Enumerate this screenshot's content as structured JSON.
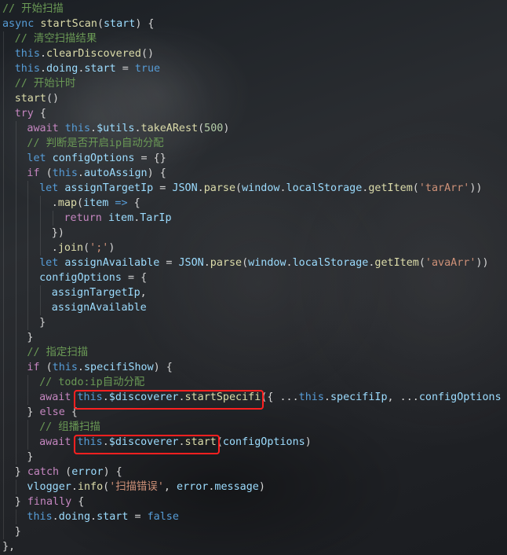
{
  "editor": {
    "lines": [
      [
        {
          "t": "// 开始扫描",
          "c": "comment"
        }
      ],
      [
        {
          "t": "async ",
          "c": "kw"
        },
        {
          "t": "startScan",
          "c": "fn"
        },
        {
          "t": "(",
          "c": "plain"
        },
        {
          "t": "start",
          "c": "var"
        },
        {
          "t": ") {",
          "c": "plain"
        }
      ],
      [
        {
          "t": "// 清空扫描结果",
          "c": "comment"
        }
      ],
      [
        {
          "t": "this",
          "c": "kw"
        },
        {
          "t": ".",
          "c": "plain"
        },
        {
          "t": "clearDiscovered",
          "c": "fn"
        },
        {
          "t": "()",
          "c": "plain"
        }
      ],
      [
        {
          "t": "this",
          "c": "kw"
        },
        {
          "t": ".",
          "c": "plain"
        },
        {
          "t": "doing",
          "c": "var"
        },
        {
          "t": ".",
          "c": "plain"
        },
        {
          "t": "start",
          "c": "var"
        },
        {
          "t": " = ",
          "c": "plain"
        },
        {
          "t": "true",
          "c": "kw"
        }
      ],
      [
        {
          "t": "// 开始计时",
          "c": "comment"
        }
      ],
      [
        {
          "t": "start",
          "c": "fn"
        },
        {
          "t": "()",
          "c": "plain"
        }
      ],
      [
        {
          "t": "try",
          "c": "ctl"
        },
        {
          "t": " {",
          "c": "plain"
        }
      ],
      [
        {
          "t": "await ",
          "c": "ctl"
        },
        {
          "t": "this",
          "c": "kw"
        },
        {
          "t": ".",
          "c": "plain"
        },
        {
          "t": "$utils",
          "c": "var"
        },
        {
          "t": ".",
          "c": "plain"
        },
        {
          "t": "takeARest",
          "c": "fn"
        },
        {
          "t": "(",
          "c": "plain"
        },
        {
          "t": "500",
          "c": "num"
        },
        {
          "t": ")",
          "c": "plain"
        }
      ],
      [
        {
          "t": "// 判断是否开启ip自动分配",
          "c": "comment"
        }
      ],
      [
        {
          "t": "let ",
          "c": "kw"
        },
        {
          "t": "configOptions",
          "c": "var"
        },
        {
          "t": " = {}",
          "c": "plain"
        }
      ],
      [
        {
          "t": "if",
          "c": "ctl"
        },
        {
          "t": " (",
          "c": "plain"
        },
        {
          "t": "this",
          "c": "kw"
        },
        {
          "t": ".",
          "c": "plain"
        },
        {
          "t": "autoAssign",
          "c": "var"
        },
        {
          "t": ") {",
          "c": "plain"
        }
      ],
      [
        {
          "t": "let ",
          "c": "kw"
        },
        {
          "t": "assignTargetIp",
          "c": "var"
        },
        {
          "t": " = ",
          "c": "plain"
        },
        {
          "t": "JSON",
          "c": "var"
        },
        {
          "t": ".",
          "c": "plain"
        },
        {
          "t": "parse",
          "c": "fn"
        },
        {
          "t": "(",
          "c": "plain"
        },
        {
          "t": "window",
          "c": "var"
        },
        {
          "t": ".",
          "c": "plain"
        },
        {
          "t": "localStorage",
          "c": "var"
        },
        {
          "t": ".",
          "c": "plain"
        },
        {
          "t": "getItem",
          "c": "fn"
        },
        {
          "t": "(",
          "c": "plain"
        },
        {
          "t": "'tarArr'",
          "c": "str"
        },
        {
          "t": "))",
          "c": "plain"
        }
      ],
      [
        {
          "t": ".",
          "c": "plain"
        },
        {
          "t": "map",
          "c": "fn"
        },
        {
          "t": "(",
          "c": "plain"
        },
        {
          "t": "item",
          "c": "var"
        },
        {
          "t": " => ",
          "c": "kw"
        },
        {
          "t": "{",
          "c": "plain"
        }
      ],
      [
        {
          "t": "return ",
          "c": "ctl"
        },
        {
          "t": "item",
          "c": "var"
        },
        {
          "t": ".",
          "c": "plain"
        },
        {
          "t": "TarIp",
          "c": "var"
        }
      ],
      [
        {
          "t": "})",
          "c": "plain"
        }
      ],
      [
        {
          "t": ".",
          "c": "plain"
        },
        {
          "t": "join",
          "c": "fn"
        },
        {
          "t": "(",
          "c": "plain"
        },
        {
          "t": "';'",
          "c": "str"
        },
        {
          "t": ")",
          "c": "plain"
        }
      ],
      [
        {
          "t": "let ",
          "c": "kw"
        },
        {
          "t": "assignAvailable",
          "c": "var"
        },
        {
          "t": " = ",
          "c": "plain"
        },
        {
          "t": "JSON",
          "c": "var"
        },
        {
          "t": ".",
          "c": "plain"
        },
        {
          "t": "parse",
          "c": "fn"
        },
        {
          "t": "(",
          "c": "plain"
        },
        {
          "t": "window",
          "c": "var"
        },
        {
          "t": ".",
          "c": "plain"
        },
        {
          "t": "localStorage",
          "c": "var"
        },
        {
          "t": ".",
          "c": "plain"
        },
        {
          "t": "getItem",
          "c": "fn"
        },
        {
          "t": "(",
          "c": "plain"
        },
        {
          "t": "'avaArr'",
          "c": "str"
        },
        {
          "t": "))",
          "c": "plain"
        }
      ],
      [
        {
          "t": "configOptions",
          "c": "var"
        },
        {
          "t": " = {",
          "c": "plain"
        }
      ],
      [
        {
          "t": "assignTargetIp",
          "c": "var"
        },
        {
          "t": ",",
          "c": "plain"
        }
      ],
      [
        {
          "t": "assignAvailable",
          "c": "var"
        }
      ],
      [
        {
          "t": "}",
          "c": "plain"
        }
      ],
      [
        {
          "t": "}",
          "c": "plain"
        }
      ],
      [
        {
          "t": "// 指定扫描",
          "c": "comment"
        }
      ],
      [
        {
          "t": "if",
          "c": "ctl"
        },
        {
          "t": " (",
          "c": "plain"
        },
        {
          "t": "this",
          "c": "kw"
        },
        {
          "t": ".",
          "c": "plain"
        },
        {
          "t": "specifiShow",
          "c": "var"
        },
        {
          "t": ") {",
          "c": "plain"
        }
      ],
      [
        {
          "t": "// todo:ip自动分配",
          "c": "comment"
        }
      ],
      [
        {
          "t": "await ",
          "c": "ctl"
        },
        {
          "t": "this",
          "c": "kw"
        },
        {
          "t": ".",
          "c": "plain"
        },
        {
          "t": "$discoverer",
          "c": "var"
        },
        {
          "t": ".",
          "c": "plain"
        },
        {
          "t": "startSpecifi",
          "c": "fn"
        },
        {
          "t": "({ ...",
          "c": "plain"
        },
        {
          "t": "this",
          "c": "kw"
        },
        {
          "t": ".",
          "c": "plain"
        },
        {
          "t": "specifiIp",
          "c": "var"
        },
        {
          "t": ", ...",
          "c": "plain"
        },
        {
          "t": "configOptions",
          "c": "var"
        },
        {
          "t": " })",
          "c": "plain"
        }
      ],
      [
        {
          "t": "} ",
          "c": "plain"
        },
        {
          "t": "else",
          "c": "ctl"
        },
        {
          "t": " {",
          "c": "plain"
        }
      ],
      [
        {
          "t": "// 组播扫描",
          "c": "comment"
        }
      ],
      [
        {
          "t": "await ",
          "c": "ctl"
        },
        {
          "t": "this",
          "c": "kw"
        },
        {
          "t": ".",
          "c": "plain"
        },
        {
          "t": "$discoverer",
          "c": "var"
        },
        {
          "t": ".",
          "c": "plain"
        },
        {
          "t": "start",
          "c": "fn"
        },
        {
          "t": "(",
          "c": "plain"
        },
        {
          "t": "configOptions",
          "c": "var"
        },
        {
          "t": ")",
          "c": "plain"
        }
      ],
      [
        {
          "t": "}",
          "c": "plain"
        }
      ],
      [
        {
          "t": "} ",
          "c": "plain"
        },
        {
          "t": "catch",
          "c": "ctl"
        },
        {
          "t": " (",
          "c": "plain"
        },
        {
          "t": "error",
          "c": "var"
        },
        {
          "t": ") {",
          "c": "plain"
        }
      ],
      [
        {
          "t": "vlogger",
          "c": "var"
        },
        {
          "t": ".",
          "c": "plain"
        },
        {
          "t": "info",
          "c": "fn"
        },
        {
          "t": "(",
          "c": "plain"
        },
        {
          "t": "'扫描错误'",
          "c": "str"
        },
        {
          "t": ", ",
          "c": "plain"
        },
        {
          "t": "error",
          "c": "var"
        },
        {
          "t": ".",
          "c": "plain"
        },
        {
          "t": "message",
          "c": "var"
        },
        {
          "t": ")",
          "c": "plain"
        }
      ],
      [
        {
          "t": "} ",
          "c": "plain"
        },
        {
          "t": "finally",
          "c": "ctl"
        },
        {
          "t": " {",
          "c": "plain"
        }
      ],
      [
        {
          "t": "this",
          "c": "kw"
        },
        {
          "t": ".",
          "c": "plain"
        },
        {
          "t": "doing",
          "c": "var"
        },
        {
          "t": ".",
          "c": "plain"
        },
        {
          "t": "start",
          "c": "var"
        },
        {
          "t": " = ",
          "c": "plain"
        },
        {
          "t": "false",
          "c": "kw"
        }
      ],
      [
        {
          "t": "}",
          "c": "plain"
        }
      ],
      [
        {
          "t": "},",
          "c": "plain"
        }
      ]
    ]
  },
  "colors": {
    "highlight_box": "#ff2020"
  }
}
